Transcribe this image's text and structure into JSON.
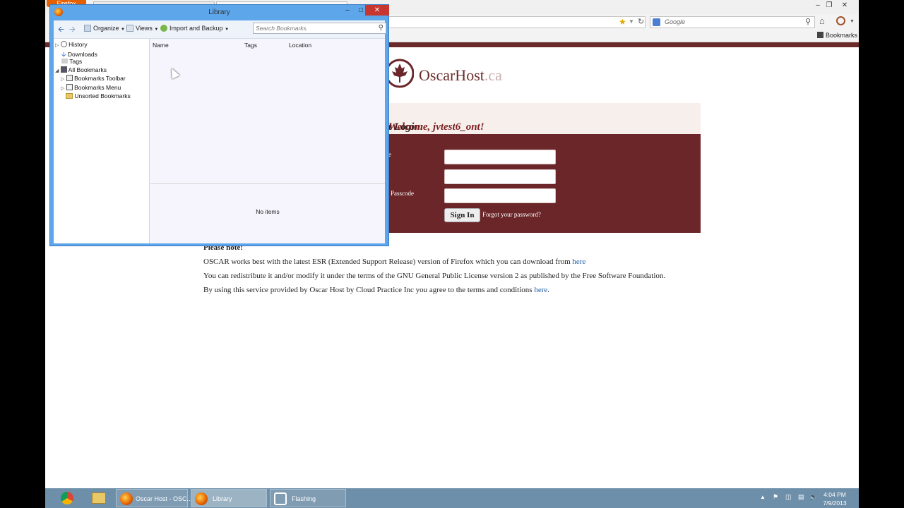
{
  "browser": {
    "menu_button": "Firefox",
    "search_placeholder": "Google",
    "bookmarks_button": "Bookmarks"
  },
  "page": {
    "logo_main": "OscarHost",
    "logo_suffix": ".ca",
    "login_title": "t Login:",
    "welcome": "Welcome, jvtest6_ont!",
    "label_username": "e",
    "label_passcode": "Passcode",
    "signin_label": "Sign In",
    "forgot_label": "Forgot your password?",
    "note_heading": "Please note:",
    "note_line1": "OSCAR works best with the latest ESR (Extended Support Release) version of Firefox which you can download from",
    "note_line1_link": "here",
    "note_line2": "You can redistribute it and/or modify it under the terms of the GNU General Public License version 2 as published by the Free Software Foundation.",
    "note_line3": "By using this service provided by Oscar Host by Cloud Practice Inc you agree to the terms and conditions",
    "note_line3_link": "here",
    "note_line3_end": "."
  },
  "library": {
    "title": "Library",
    "toolbar": {
      "organize": "Organize",
      "views": "Views",
      "import_backup": "Import and Backup",
      "search_placeholder": "Search Bookmarks"
    },
    "tree": [
      {
        "label": "History",
        "icon": "clock-icon"
      },
      {
        "label": "Downloads",
        "icon": "download-icon"
      },
      {
        "label": "Tags",
        "icon": "tag-icon"
      },
      {
        "label": "All Bookmarks",
        "icon": "bookmarks-icon"
      },
      {
        "label": "Bookmarks Toolbar",
        "icon": "toolbar-icon"
      },
      {
        "label": "Bookmarks Menu",
        "icon": "menu-icon"
      },
      {
        "label": "Unsorted Bookmarks",
        "icon": "folder-icon"
      }
    ],
    "columns": [
      "Name",
      "Tags",
      "Location"
    ],
    "empty_text": "No items"
  },
  "taskbar": {
    "apps": [
      {
        "label": "",
        "icon": "chrome-icon"
      },
      {
        "label": "",
        "icon": "explorer-icon"
      },
      {
        "label": "Oscar Host - OSC...",
        "icon": "firefox-icon"
      },
      {
        "label": "Library",
        "icon": "firefox-icon"
      },
      {
        "label": "Flashing",
        "icon": "app-icon"
      }
    ],
    "time": "4:04 PM",
    "date": "7/9/2013"
  },
  "colors": {
    "brand": "#6b2629",
    "accent_link": "#1f5ea8",
    "taskbar": "#6e8fa9",
    "window_frame": "#5ea6ea"
  }
}
